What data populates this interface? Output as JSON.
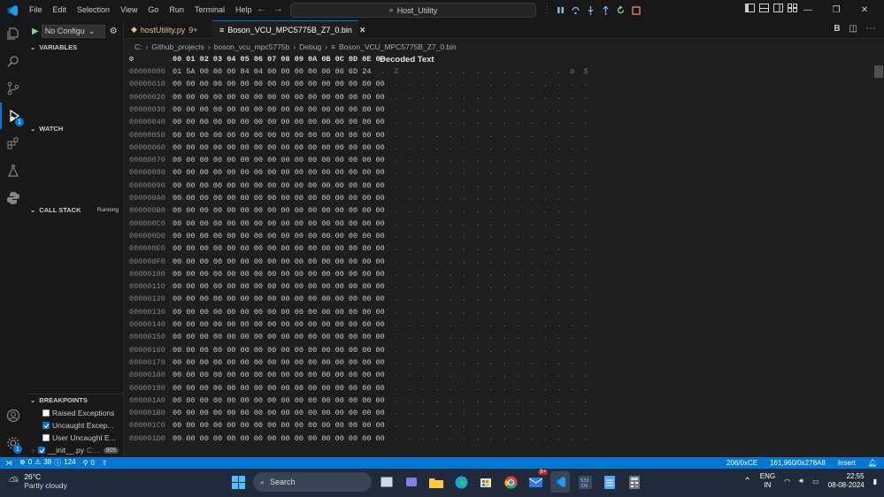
{
  "menu": [
    "File",
    "Edit",
    "Selection",
    "View",
    "Go",
    "Run",
    "Terminal",
    "Help"
  ],
  "command_center": "Host_Utility",
  "run_config": "No Configu",
  "sections": {
    "variables": "VARIABLES",
    "watch": "WATCH",
    "call_stack": "CALL STACK",
    "call_stack_status": "Running",
    "breakpoints": "BREAKPOINTS"
  },
  "breakpoints": [
    {
      "label": "Raised Exceptions",
      "checked": false
    },
    {
      "label": "Uncaught Excep...",
      "checked": true
    },
    {
      "label": "User Uncaught E...",
      "checked": false
    },
    {
      "label": "__init__.py",
      "sub": "C:...",
      "line": "905",
      "checked": true
    }
  ],
  "tabs": [
    {
      "label": "hostUtility.py",
      "badge": "9+",
      "active": false
    },
    {
      "label": "Boson_VCU_MPC5775B_Z7_0.bin",
      "active": true
    }
  ],
  "breadcrumb": [
    "C:",
    "Github_projects",
    "boson_vcu_mpc5775b",
    "Debug",
    "Boson_VCU_MPC5775B_Z7_0.bin"
  ],
  "hex": {
    "columns": "00 01 02 03 04 05 06 07 08 09 0A 0B 0C 0D 0E 0F",
    "decoded_header": "Decoded Text",
    "rows": [
      {
        "addr": "00000000",
        "bytes": "01 5A 00 00 00 84 04 00 00 00 00 00 86 6D 24",
        "decoded": ".  Z  .  .  .  .  .  .  .  .  .  .  .  .  m  $"
      },
      {
        "addr": "00000010",
        "bytes": "00 00 00 00 00 00 00 00 00 00 00 00 00 00 00 00",
        "decoded": ".  .  .  .  .  .  .  .  .  .  .  .  .  .  .  ."
      },
      {
        "addr": "00000020",
        "bytes": "00 00 00 00 00 00 00 00 00 00 00 00 00 00 00 00",
        "decoded": ".  .  .  .  .  .  .  .  .  .  .  .  .  .  .  ."
      },
      {
        "addr": "00000030",
        "bytes": "00 00 00 00 00 00 00 00 00 00 00 00 00 00 00 00",
        "decoded": ".  .  .  .  .  .  .  .  .  .  .  .  .  .  .  ."
      },
      {
        "addr": "00000040",
        "bytes": "00 00 00 00 00 00 00 00 00 00 00 00 00 00 00 00",
        "decoded": ".  .  .  .  .  .  .  .  .  .  .  .  .  .  .  ."
      },
      {
        "addr": "00000050",
        "bytes": "00 00 00 00 00 00 00 00 00 00 00 00 00 00 00 00",
        "decoded": ".  .  .  .  .  .  .  .  .  .  .  .  .  .  .  ."
      },
      {
        "addr": "00000060",
        "bytes": "00 00 00 00 00 00 00 00 00 00 00 00 00 00 00 00",
        "decoded": ".  .  .  .  .  .  .  .  .  .  .  .  .  .  .  ."
      },
      {
        "addr": "00000070",
        "bytes": "00 00 00 00 00 00 00 00 00 00 00 00 00 00 00 00",
        "decoded": ".  .  .  .  .  .  .  .  .  .  .  .  .  .  .  ."
      },
      {
        "addr": "00000080",
        "bytes": "00 00 00 00 00 00 00 00 00 00 00 00 00 00 00 00",
        "decoded": ".  .  .  .  .  .  .  .  .  .  .  .  .  .  .  ."
      },
      {
        "addr": "00000090",
        "bytes": "00 00 00 00 00 00 00 00 00 00 00 00 00 00 00 00",
        "decoded": ".  .  .  .  .  .  .  .  .  .  .  .  .  .  .  ."
      },
      {
        "addr": "000000A0",
        "bytes": "00 00 00 00 00 00 00 00 00 00 00 00 00 00 00 00",
        "decoded": ".  .  .  .  .  .  .  .  .  .  .  .  .  .  .  ."
      },
      {
        "addr": "000000B0",
        "bytes": "00 00 00 00 00 00 00 00 00 00 00 00 00 00 00 00",
        "decoded": ".  .  .  .  .  .  .  .  .  .  .  .  .  .  .  ."
      },
      {
        "addr": "000000C0",
        "bytes": "00 00 00 00 00 00 00 00 00 00 00 00 00 00 00 00",
        "decoded": ".  .  .  .  .  .  .  .  .  .  .  .  .  .  .  ."
      },
      {
        "addr": "000000D0",
        "bytes": "00 00 00 00 00 00 00 00 00 00 00 00 00 00 00 00",
        "decoded": ".  .  .  .  .  .  .  .  .  .  .  .  .  .  .  ."
      },
      {
        "addr": "000000E0",
        "bytes": "00 00 00 00 00 00 00 00 00 00 00 00 00 00 00 00",
        "decoded": ".  .  .  .  .  .  .  .  .  .  .  .  .  .  .  ."
      },
      {
        "addr": "000000F0",
        "bytes": "00 00 00 00 00 00 00 00 00 00 00 00 00 00 00 00",
        "decoded": ".  .  .  .  .  .  .  .  .  .  .  .  .  .  .  ."
      },
      {
        "addr": "00000100",
        "bytes": "00 00 00 00 00 00 00 00 00 00 00 00 00 00 00 00",
        "decoded": ".  .  .  .  .  .  .  .  .  .  .  .  .  .  .  ."
      },
      {
        "addr": "00000110",
        "bytes": "00 00 00 00 00 00 00 00 00 00 00 00 00 00 00 00",
        "decoded": ".  .  .  .  .  .  .  .  .  .  .  .  .  .  .  ."
      },
      {
        "addr": "00000120",
        "bytes": "00 00 00 00 00 00 00 00 00 00 00 00 00 00 00 00",
        "decoded": ".  .  .  .  .  .  .  .  .  .  .  .  .  .  .  ."
      },
      {
        "addr": "00000130",
        "bytes": "00 00 00 00 00 00 00 00 00 00 00 00 00 00 00 00",
        "decoded": ".  .  .  .  .  .  .  .  .  .  .  .  .  .  .  ."
      },
      {
        "addr": "00000140",
        "bytes": "00 00 00 00 00 00 00 00 00 00 00 00 00 00 00 00",
        "decoded": ".  .  .  .  .  .  .  .  .  .  .  .  .  .  .  ."
      },
      {
        "addr": "00000150",
        "bytes": "00 00 00 00 00 00 00 00 00 00 00 00 00 00 00 00",
        "decoded": ".  .  .  .  .  .  .  .  .  .  .  .  .  .  .  ."
      },
      {
        "addr": "00000160",
        "bytes": "00 00 00 00 00 00 00 00 00 00 00 00 00 00 00 00",
        "decoded": ".  .  .  .  .  .  .  .  .  .  .  .  .  .  .  ."
      },
      {
        "addr": "00000170",
        "bytes": "00 00 00 00 00 00 00 00 00 00 00 00 00 00 00 00",
        "decoded": ".  .  .  .  .  .  .  .  .  .  .  .  .  .  .  ."
      },
      {
        "addr": "00000180",
        "bytes": "00 00 00 00 00 00 00 00 00 00 00 00 00 00 00 00",
        "decoded": ".  .  .  .  .  .  .  .  .  .  .  .  .  .  .  ."
      },
      {
        "addr": "00000190",
        "bytes": "00 00 00 00 00 00 00 00 00 00 00 00 00 00 00 00",
        "decoded": ".  .  .  .  .  .  .  .  .  .  .  .  .  .  .  ."
      },
      {
        "addr": "000001A0",
        "bytes": "00 00 00 00 00 00 00 00 00 00 00 00 00 00 00 00",
        "decoded": ".  .  .  .  .  .  .  .  .  .  .  .  .  .  .  ."
      },
      {
        "addr": "000001B0",
        "bytes": "00 00 00 00 00 00 00 00 00 00 00 00 00 00 00 00",
        "decoded": ".  .  .  .  .  .  .  .  .  .  .  .  .  .  .  ."
      },
      {
        "addr": "000001C0",
        "bytes": "00 00 00 00 00 00 00 00 00 00 00 00 00 00 00 00",
        "decoded": ".  .  .  .  .  .  .  .  .  .  .  .  .  .  .  ."
      },
      {
        "addr": "000001D0",
        "bytes": "00 00 00 00 00 00 00 00 00 00 00 00 00 00 00 00",
        "decoded": ".  .  .  .  .  .  .  .  .  .  .  .  .  .  .  ."
      }
    ]
  },
  "status": {
    "errors": "0",
    "warnings": "38",
    "info": "124",
    "ports": "0",
    "position": "206/0xCE",
    "size": "161,960/0x278A8",
    "mode": "Insert"
  },
  "taskbar": {
    "temp": "26°C",
    "weather": "Partly cloudy",
    "search": "Search",
    "lang1": "ENG",
    "lang2": "IN",
    "time": "22:55",
    "date": "08-08-2024",
    "mail_badge": "9+"
  },
  "colors": {
    "accent": "#0078d4",
    "statusbar": "#0078d4"
  }
}
